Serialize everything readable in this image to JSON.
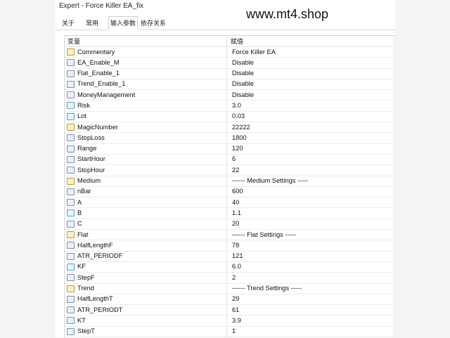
{
  "window": {
    "title": "Expert - Force Killer EA_fix"
  },
  "watermark": "www.mt4.shop",
  "tabs": [
    {
      "label": "关于"
    },
    {
      "label": "常用"
    },
    {
      "label": "输入参数"
    },
    {
      "label": "依存关系"
    }
  ],
  "grid": {
    "col_variable": "变量",
    "col_value": "赋值",
    "rows": [
      {
        "name": "Commentary",
        "value": "Force Killer EA",
        "type": "string"
      },
      {
        "name": "EA_Enable_M",
        "value": "Disable",
        "type": "int"
      },
      {
        "name": "Flat_Enable_1",
        "value": "Disable",
        "type": "int"
      },
      {
        "name": "Trend_Enable_1",
        "value": "Disable",
        "type": "int"
      },
      {
        "name": "MoneyManagement",
        "value": "Disable",
        "type": "int"
      },
      {
        "name": "Risk",
        "value": "3.0",
        "type": "double"
      },
      {
        "name": "Lot",
        "value": "0.03",
        "type": "double"
      },
      {
        "name": "MagicNumber",
        "value": "22222",
        "type": "string"
      },
      {
        "name": "StopLoss",
        "value": "1800",
        "type": "int"
      },
      {
        "name": "Range",
        "value": "120",
        "type": "int"
      },
      {
        "name": "StartHour",
        "value": "6",
        "type": "int"
      },
      {
        "name": "StopHour",
        "value": "22",
        "type": "int"
      },
      {
        "name": "Medium",
        "value": "------ Medium Settings -----",
        "type": "string"
      },
      {
        "name": "nBar",
        "value": "600",
        "type": "int"
      },
      {
        "name": "A",
        "value": "40",
        "type": "int"
      },
      {
        "name": "B",
        "value": "1.1",
        "type": "double"
      },
      {
        "name": "C",
        "value": "20",
        "type": "int"
      },
      {
        "name": "Flat",
        "value": "------ Flat Settings  -----",
        "type": "string"
      },
      {
        "name": "HalfLengthF",
        "value": "78",
        "type": "int"
      },
      {
        "name": "ATR_PERIODF",
        "value": "121",
        "type": "int"
      },
      {
        "name": "KF",
        "value": "6.0",
        "type": "double"
      },
      {
        "name": "StepF",
        "value": "2",
        "type": "int"
      },
      {
        "name": "Trend",
        "value": "------ Trend Settings  -----",
        "type": "string"
      },
      {
        "name": "HalfLengthT",
        "value": "29",
        "type": "int"
      },
      {
        "name": "ATR_PERIODT",
        "value": "61",
        "type": "int"
      },
      {
        "name": "KT",
        "value": "3.9",
        "type": "double"
      },
      {
        "name": "StepT",
        "value": "1",
        "type": "int"
      }
    ]
  }
}
